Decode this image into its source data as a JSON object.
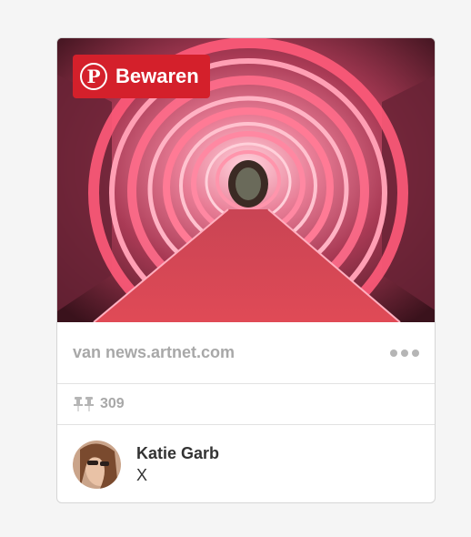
{
  "pin": {
    "save_label": "Bewaren",
    "source": "van news.artnet.com",
    "repin_count": "309",
    "user_name": "Katie Garb",
    "board_name": "X"
  },
  "icons": {
    "brand": "pinterest-logo-icon",
    "more": "more-options-icon",
    "repin": "pin-icon",
    "avatar": "user-avatar"
  },
  "colors": {
    "save_button": "#d4202b",
    "muted_text": "#a8a8a8",
    "body_text": "#333333",
    "card_border": "#d6d6d6"
  }
}
